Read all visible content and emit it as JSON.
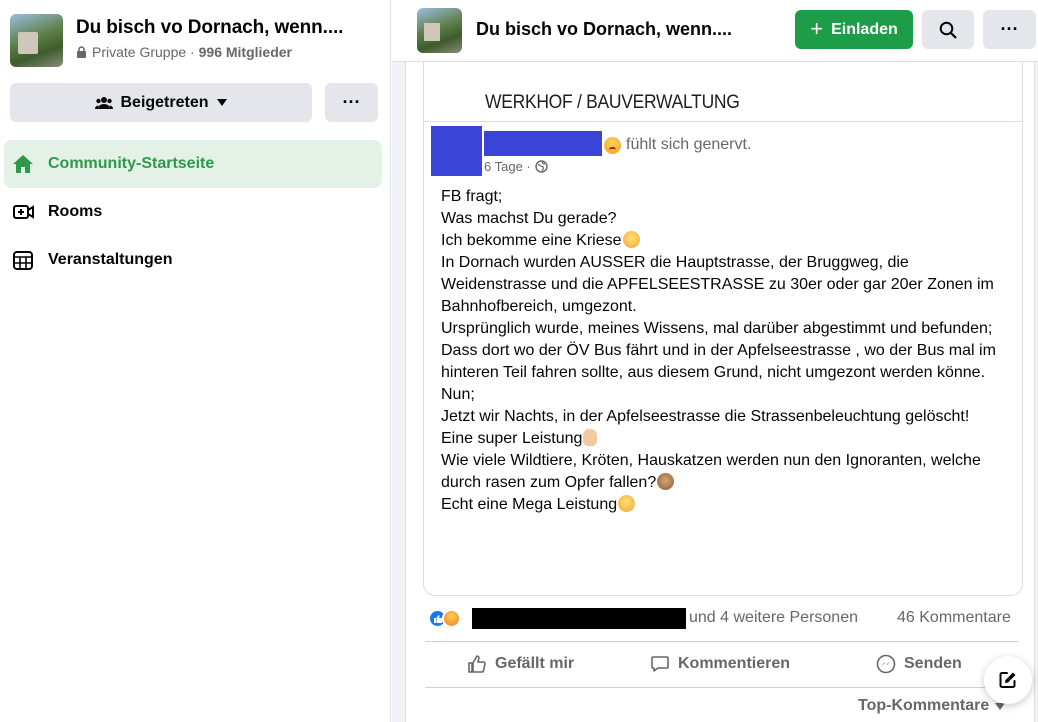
{
  "group": {
    "title": "Du bisch vo Dornach, wenn....",
    "privacy": "Private Gruppe",
    "members": "996 Mitglieder",
    "joined_label": "Beigetreten",
    "more_label": "···"
  },
  "nav": {
    "items": [
      {
        "label": "Community-Startseite",
        "icon": "home-icon",
        "active": true
      },
      {
        "label": "Rooms",
        "icon": "rooms-icon",
        "active": false
      },
      {
        "label": "Veranstaltungen",
        "icon": "calendar-icon",
        "active": false
      }
    ]
  },
  "topbar": {
    "title": "Du bisch vo Dornach, wenn....",
    "invite_label": "Einladen",
    "more_label": "···"
  },
  "post": {
    "section_heading": "WERKHOF / BAUVERWALTUNG",
    "feeling": "fühlt sich genervt.",
    "time": "6 Tage ·",
    "lines": [
      "FB fragt;",
      "Was machst Du gerade?",
      "Ich bekomme eine Kriese",
      "In Dornach wurden AUSSER die Hauptstrasse, der Bruggweg, die Weidenstrasse und die APFELSEESTRASSE zu 30er oder gar 20er Zonen im Bahnhofbereich, umgezont.",
      "Ursprünglich wurde, meines Wissens, mal darüber abgestimmt und befunden;",
      "Dass dort wo der ÖV Bus fährt und in der Apfelseestrasse , wo der Bus mal im hinteren Teil fahren sollte, aus diesem Grund, nicht umgezont werden könne.",
      "Nun;",
      "Jetzt wir Nachts, in der Apfelseestrasse die Strassenbeleuchtung gelöscht!",
      "Eine super Leistung",
      "Wie viele Wildtiere, Kröten, Hauskatzen werden nun den Ignoranten, welche durch rasen zum Opfer fallen?",
      "Echt eine Mega Leistung"
    ],
    "reactions_text": "und 4 weitere Personen",
    "comments_count": "46 Kommentare",
    "actions": {
      "like": "Gefällt mir",
      "comment": "Kommentieren",
      "send": "Senden"
    },
    "sort_label": "Top-Kommentare"
  },
  "colors": {
    "accent_green": "#1e9d48",
    "active_nav_bg": "#e3f1e6",
    "redaction_blue": "#3a44d6",
    "like_blue": "#1877f2"
  }
}
